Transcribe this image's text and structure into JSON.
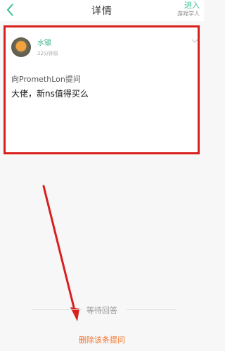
{
  "header": {
    "title": "详情",
    "enter_label": "进入",
    "enter_sublabel": "游戏学人"
  },
  "question": {
    "username": "水银",
    "time_ago": "22分钟前",
    "asked_to": "向PromethLon提问",
    "text": "大佬，新ns值得买么"
  },
  "footer": {
    "waiting_label": "等待回答",
    "delete_label": "删除该条提问"
  },
  "colors": {
    "accent": "#35c38f",
    "highlight_border": "#d8201e",
    "delete": "#f2752e",
    "arrow": "#d8201e"
  }
}
